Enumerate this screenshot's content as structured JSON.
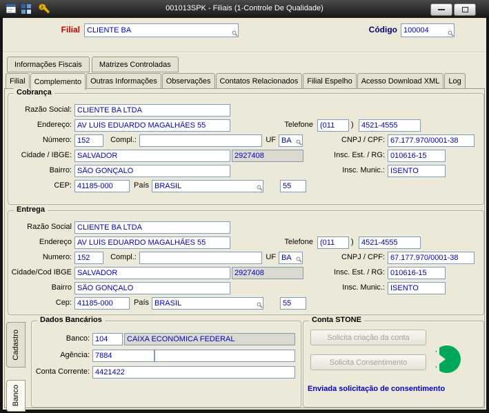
{
  "window": {
    "title": "001013SPK - Filiais (1-Controle De Qualidade)"
  },
  "header": {
    "filial_label": "Filial",
    "filial_value": "CLIENTE BA",
    "codigo_label": "Código",
    "codigo_value": "100004"
  },
  "tabs_upper": {
    "items": [
      "Informações Fiscais",
      "Matrizes Controladas"
    ]
  },
  "tabs_main": {
    "items": [
      "Filial",
      "Complemento",
      "Outras Informações",
      "Observações",
      "Contatos Relacionados",
      "Filial Espelho",
      "Acesso Download XML",
      "Log"
    ],
    "active": "Complemento"
  },
  "cobranca": {
    "title": "Cobrança",
    "razao_social_label": "Razão Social:",
    "razao_social": "CLIENTE BA LTDA",
    "endereco_label": "Endereço:",
    "endereco": "AV LUÍS EDUARDO MAGALHÃES 55",
    "numero_label": "Número:",
    "numero": "152",
    "compl_label": "Compl.:",
    "compl": "",
    "uf_label": "UF",
    "uf": "BA",
    "cidade_label": "Cidade / IBGE:",
    "cidade": "SALVADOR",
    "ibge": "2927408",
    "bairro_label": "Bairro:",
    "bairro": "SÃO GONÇALO",
    "cep_label": "CEP:",
    "cep": "41185-000",
    "pais_label": "País",
    "pais": "BRASIL",
    "pais_codigo": "55",
    "telefone_label": "Telefone",
    "telefone_ddd": "(011",
    "telefone_paren": ")",
    "telefone": "4521-4555",
    "cnpj_label": "CNPJ / CPF:",
    "cnpj": "67.177.970/0001-38",
    "insc_est_label": "Insc. Est. / RG:",
    "insc_est": "010616-15",
    "insc_munic_label": "Insc. Munic.:",
    "insc_munic": "ISENTO"
  },
  "entrega": {
    "title": "Entrega",
    "razao_social_label": "Razão Social",
    "razao_social": "CLIENTE BA LTDA",
    "endereco_label": "Endereço",
    "endereco": "AV LUÍS EDUARDO MAGALHÃES 55",
    "numero_label": "Numero:",
    "numero": "152",
    "compl_label": "Compl.:",
    "compl": "",
    "uf_label": "UF",
    "uf": "BA",
    "cidade_label": "Cidade/Cod IBGE",
    "cidade": "SALVADOR",
    "ibge": "2927408",
    "bairro_label": "Bairro",
    "bairro": "SÃO GONÇALO",
    "cep_label": "Cep:",
    "cep": "41185-000",
    "pais_label": "País",
    "pais": "BRASIL",
    "pais_codigo": "55",
    "telefone_label": "Telefone",
    "telefone_ddd": "(011",
    "telefone_paren": ")",
    "telefone": "4521-4555",
    "cnpj_label": "CNPJ / CPF:",
    "cnpj": "67.177.970/0001-38",
    "insc_est_label": "Insc. Est. / RG:",
    "insc_est": "010616-15",
    "insc_munic_label": "Insc. Munic.:",
    "insc_munic": "ISENTO"
  },
  "bottom": {
    "side_tabs": [
      "Cadastro",
      "Banco"
    ],
    "side_tabs_active": "Banco",
    "dados_bancarios": {
      "title": "Dados Bancários",
      "banco_label": "Banco:",
      "banco_codigo": "104",
      "banco_nome": "CAIXA ECONÔMICA FEDERAL",
      "agencia_label": "Agência:",
      "agencia": "7884",
      "agencia_compl": "",
      "conta_corrente_label": "Conta Corrente:",
      "conta_corrente": "4421422"
    },
    "conta_stone": {
      "title": "Conta STONE",
      "solicita_criacao_button": "Solicita criação da conta",
      "solicita_consentimento_button": "Solicita Consentimento",
      "status": "Enviada solicitação de consentimento"
    }
  },
  "colors": {
    "accent_red": "#cc0000",
    "accent_navy": "#00007a",
    "value_blue": "#0000c8",
    "status_blue": "#0000cc",
    "stone_green": "#00a859",
    "background": "#ece9d8"
  }
}
